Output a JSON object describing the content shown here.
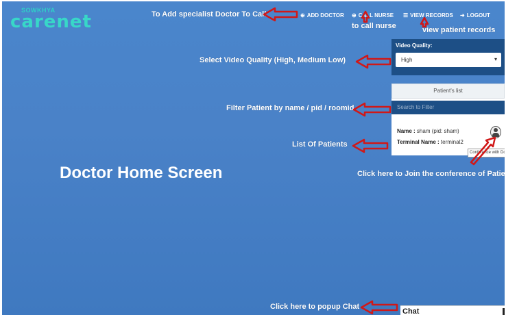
{
  "logo": {
    "small": "SOWKHYA",
    "big": "carenet"
  },
  "nav": {
    "add_doctor": "ADD DOCTOR",
    "call_nurse": "CALL NURSE",
    "view_records": "VIEW RECORDS",
    "logout": "LOGOUT"
  },
  "annotations": {
    "add_doctor": "To Add specialist Doctor To Call",
    "call_nurse": "to call nurse",
    "view_records": "view patient records",
    "video_quality": "Select Video Quality (High, Medium Low)",
    "filter": "Filter Patient by name / pid / roomid",
    "list": "List Of Patients",
    "join": "Click here to Join the conference of Patient",
    "chat": "Click here to popup Chat"
  },
  "page_title": "Doctor Home Screen",
  "video_quality": {
    "label": "Video Quality:",
    "selected": "High"
  },
  "patients": {
    "header": "Patient's list",
    "filter_placeholder": "Search to Filter",
    "items": [
      {
        "name_label": "Name :",
        "name": "sham (pid: sham)",
        "terminal_label": "Terminal Name :",
        "terminal": "terminal2"
      }
    ],
    "tooltip": "Conference with Doctor"
  },
  "chat": {
    "label": "Chat"
  },
  "colors": {
    "background": "#4a84c9",
    "panel": "#1d4f86",
    "arrow": "#d01818",
    "logo": "#38d7c8"
  }
}
